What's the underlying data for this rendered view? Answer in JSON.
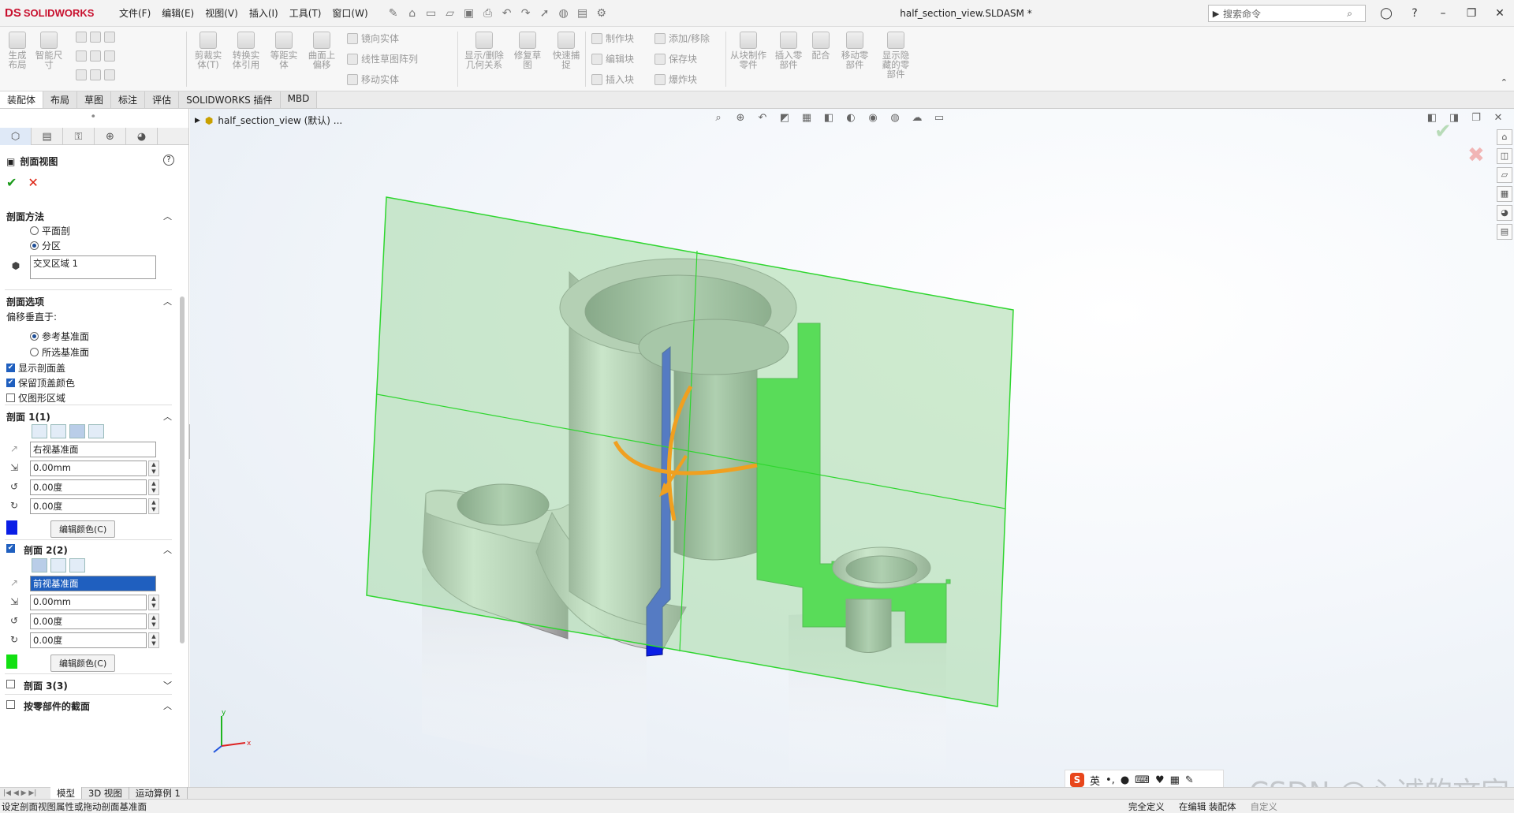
{
  "app": {
    "brand": "SOLIDWORKS",
    "brand_mark": "DS",
    "document_title": "half_section_view.SLDASM *"
  },
  "menu": [
    "文件(F)",
    "编辑(E)",
    "视图(V)",
    "插入(I)",
    "工具(T)",
    "窗口(W)"
  ],
  "search": {
    "placeholder": "搜索命令"
  },
  "ribbon": {
    "big_buttons": [
      "生成布局",
      "智能尺寸",
      "剪裁实体(T)",
      "转换实体引用",
      "等距实体",
      "曲面上偏移",
      "显示/删除几何关系",
      "修复草图",
      "快速捕捉",
      "从块制作零件",
      "插入零部件",
      "配合",
      "移动零部件",
      "显示隐藏的零部件"
    ],
    "small_buttons": [
      "镜向实体",
      "线性草图阵列",
      "移动实体",
      "制作块",
      "编辑块",
      "插入块",
      "添加/移除",
      "保存块",
      "爆炸块"
    ]
  },
  "cmd_tabs": [
    "装配体",
    "布局",
    "草图",
    "标注",
    "评估",
    "SOLIDWORKS 插件",
    "MBD"
  ],
  "panel": {
    "title": "剖面视图",
    "method": {
      "header": "剖面方法",
      "opt1": "平面剖",
      "opt2": "分区",
      "zone_value": "交叉区域 1"
    },
    "options": {
      "header": "剖面选项",
      "offset_label": "偏移垂直于:",
      "opt_ref": "参考基准面",
      "opt_sel": "所选基准面",
      "chk_show_caps": "显示剖面盖",
      "chk_keep_cap_color": "保留顶盖颜色",
      "chk_graphics_only": "仅图形区域"
    },
    "section1": {
      "header": "剖面 1(1)",
      "plane": "右视基准面",
      "offset": "0.00mm",
      "angle_x": "0.00度",
      "angle_y": "0.00度",
      "edit_color": "编辑颜色(C)",
      "color": "#0a1ee6"
    },
    "section2": {
      "header": "剖面 2(2)",
      "plane": "前视基准面",
      "offset": "0.00mm",
      "angle_x": "0.00度",
      "angle_y": "0.00度",
      "edit_color": "编辑颜色(C)",
      "color": "#12e012"
    },
    "section3": {
      "header": "剖面 3(3)"
    },
    "by_component": {
      "header": "按零部件的截面"
    }
  },
  "tree": {
    "root": "half_section_view (默认) ..."
  },
  "bottom_tabs": [
    "模型",
    "3D 视图",
    "运动算例 1"
  ],
  "status": {
    "hint": "设定剖面视图属性或拖动剖面基准面",
    "state1": "完全定义",
    "state2": "在编辑 装配体",
    "state3": "自定义"
  },
  "ime": {
    "lang": "英"
  },
  "watermark": "CSDN @心诚的文字",
  "axes": {
    "x": "x",
    "y": "y"
  },
  "colors": {
    "accent": "#1f5fbf",
    "section_plane": "#9fd89f",
    "section1_fill": "#0a1ee6",
    "section2_fill": "#12e012",
    "handle": "#f0a020"
  }
}
